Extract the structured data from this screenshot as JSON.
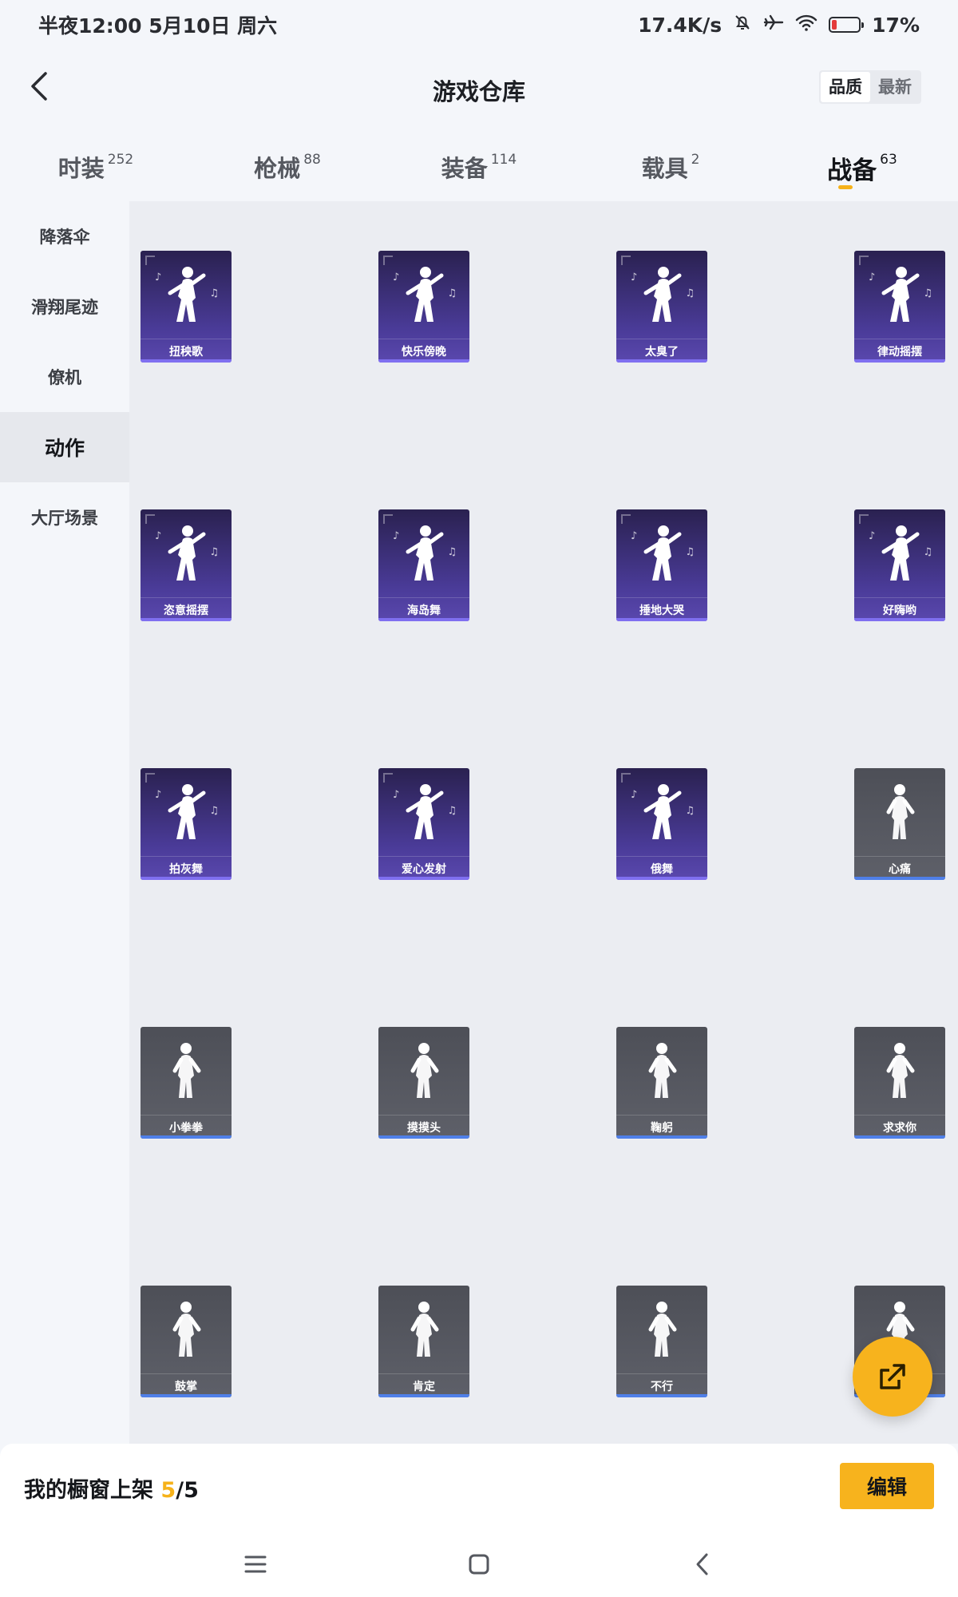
{
  "status_bar": {
    "time": "半夜12:00 5月10日 周六",
    "network_speed": "17.4K/s",
    "battery_text": "17%",
    "battery_level": 0.17
  },
  "header": {
    "title": "游戏仓库",
    "sort_options": [
      "品质",
      "最新"
    ],
    "sort_active": "品质"
  },
  "category_tabs": [
    {
      "name": "时装",
      "count": "252"
    },
    {
      "name": "枪械",
      "count": "88"
    },
    {
      "name": "装备",
      "count": "114"
    },
    {
      "name": "载具",
      "count": "2"
    },
    {
      "name": "战备",
      "count": "63",
      "active": true
    }
  ],
  "sidebar": {
    "items": [
      "降落伞",
      "滑翔尾迹",
      "僚机",
      "动作",
      "大厅场景"
    ],
    "active": "动作"
  },
  "items": [
    {
      "name": "扭秧歌",
      "tier": "purple",
      "icon": "dancer-fan-icon"
    },
    {
      "name": "快乐傍晚",
      "tier": "purple",
      "icon": "dancer-arms-icon"
    },
    {
      "name": "太臭了",
      "tier": "purple",
      "icon": "dancer-nose-icon"
    },
    {
      "name": "律动摇摆",
      "tier": "purple",
      "icon": "dancer-swing-icon"
    },
    {
      "name": "恣意摇摆",
      "tier": "purple",
      "icon": "dancer-sway-icon"
    },
    {
      "name": "海岛舞",
      "tier": "purple",
      "icon": "dancer-island-icon"
    },
    {
      "name": "捶地大哭",
      "tier": "purple",
      "icon": "dancer-crawl-icon"
    },
    {
      "name": "好嗨哟",
      "tier": "purple",
      "icon": "dancer-hype-icon"
    },
    {
      "name": "拍灰舞",
      "tier": "purple",
      "icon": "dancer-dust-icon"
    },
    {
      "name": "爱心发射",
      "tier": "purple",
      "icon": "dancer-heart-icon"
    },
    {
      "name": "俄舞",
      "tier": "purple",
      "icon": "dancer-russian-icon"
    },
    {
      "name": "心痛",
      "tier": "gray",
      "icon": "figure-heartache-icon"
    },
    {
      "name": "小拳拳",
      "tier": "gray",
      "icon": "figure-fist-icon"
    },
    {
      "name": "摸摸头",
      "tier": "gray",
      "icon": "figure-pat-head-icon"
    },
    {
      "name": "鞠躬",
      "tier": "gray",
      "icon": "figure-bow-icon"
    },
    {
      "name": "求求你",
      "tier": "gray",
      "icon": "figure-beg-icon"
    },
    {
      "name": "鼓掌",
      "tier": "gray",
      "icon": "clapping-hands-icon"
    },
    {
      "name": "肯定",
      "tier": "gray",
      "icon": "head-nod-icon"
    },
    {
      "name": "不行",
      "tier": "gray",
      "icon": "head-shake-icon"
    },
    {
      "name": "",
      "tier": "gray",
      "icon": "pointing-hand-icon"
    }
  ],
  "bottom_bar": {
    "label": "我的橱窗上架",
    "count_current": "5",
    "count_total": "/5",
    "edit_label": "编辑"
  },
  "colors": {
    "accent": "#f7b31d",
    "purple_tier": "#4a3b98",
    "gray_tier": "#5e6069"
  }
}
